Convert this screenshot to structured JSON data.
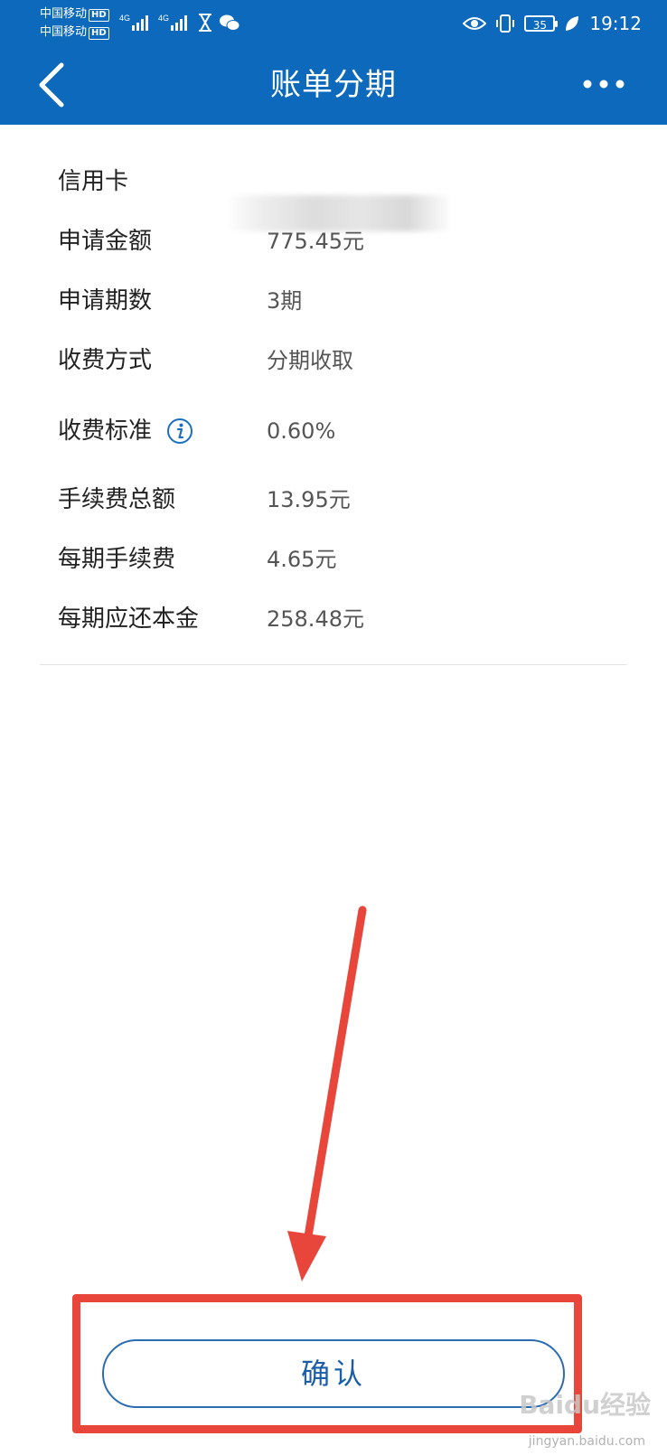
{
  "status_bar": {
    "carrier_1": "中国移动",
    "carrier_2": "中国移动",
    "hd_badge": "HD",
    "signal_label_1": "4G",
    "signal_label_2": "4G",
    "battery": "35",
    "time": "19:12"
  },
  "nav": {
    "title": "账单分期",
    "back_icon": "chevron-left-icon",
    "more_icon": "more-dots-icon"
  },
  "details": [
    {
      "label": "信用卡",
      "value": ""
    },
    {
      "label": "申请金额",
      "value": "775.45元"
    },
    {
      "label": "申请期数",
      "value": "3期"
    },
    {
      "label": "收费方式",
      "value": "分期收取"
    },
    {
      "label": "收费标准",
      "value": "0.60%"
    },
    {
      "label": "手续费总额",
      "value": "13.95元"
    },
    {
      "label": "每期手续费",
      "value": "4.65元"
    },
    {
      "label": "每期应还本金",
      "value": "258.48元"
    }
  ],
  "confirm_button": "确认",
  "watermark": {
    "text": "Baidu经验",
    "sub": "jingyan.baidu.com"
  },
  "colors": {
    "header_bg": "#0c69bb",
    "accent_blue": "#1a5ea8",
    "annotation_red": "#e8463b"
  }
}
